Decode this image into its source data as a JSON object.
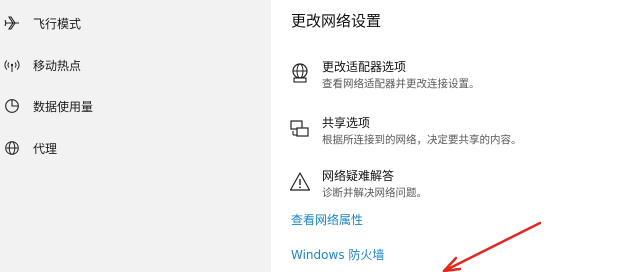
{
  "sidebar": {
    "items": [
      {
        "label": "飞行模式",
        "icon": "airplane-icon"
      },
      {
        "label": "移动热点",
        "icon": "hotspot-icon"
      },
      {
        "label": "数据使用量",
        "icon": "data-usage-icon"
      },
      {
        "label": "代理",
        "icon": "globe-icon"
      }
    ]
  },
  "main": {
    "title": "更改网络设置",
    "options": [
      {
        "title": "更改适配器选项",
        "desc": "查看网络适配器并更改连接设置。",
        "icon": "adapter-globe-icon"
      },
      {
        "title": "共享选项",
        "desc": "根据所连接到的网络，决定要共享的内容。",
        "icon": "sharing-icon"
      },
      {
        "title": "网络疑难解答",
        "desc": "诊断并解决网络问题。",
        "icon": "warning-icon"
      }
    ],
    "links": {
      "properties": "查看网络属性",
      "firewall": "Windows 防火墙"
    }
  },
  "colors": {
    "sidebar_bg": "#f2f2f2",
    "link": "#1d86c6",
    "annotation_arrow": "#e0271d"
  }
}
